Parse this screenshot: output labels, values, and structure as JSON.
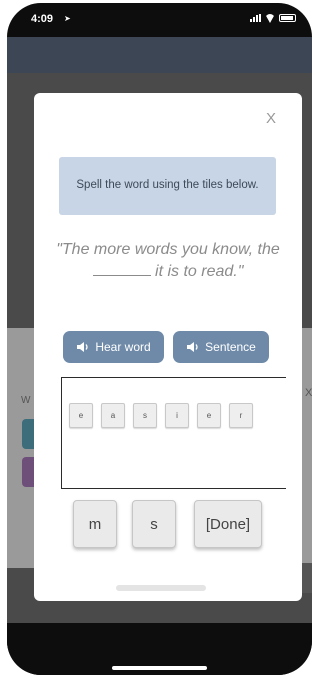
{
  "status_bar": {
    "time": "4:09"
  },
  "modal": {
    "close_label": "X",
    "instruction": "Spell the word using the tiles below.",
    "sentence_before": "\"The more words you know, the ",
    "sentence_after": " it is to read.\"",
    "buttons": {
      "hear_word": "Hear word",
      "sentence": "Sentence"
    },
    "tiles": [
      "e",
      "a",
      "s",
      "i",
      "e",
      "r"
    ],
    "keys": [
      "m",
      "s",
      "[Done]"
    ]
  },
  "background": {
    "partial_letter": "W",
    "partial_close": "X"
  },
  "icons": {
    "speaker": "speaker-icon",
    "location": "location-arrow-icon"
  }
}
